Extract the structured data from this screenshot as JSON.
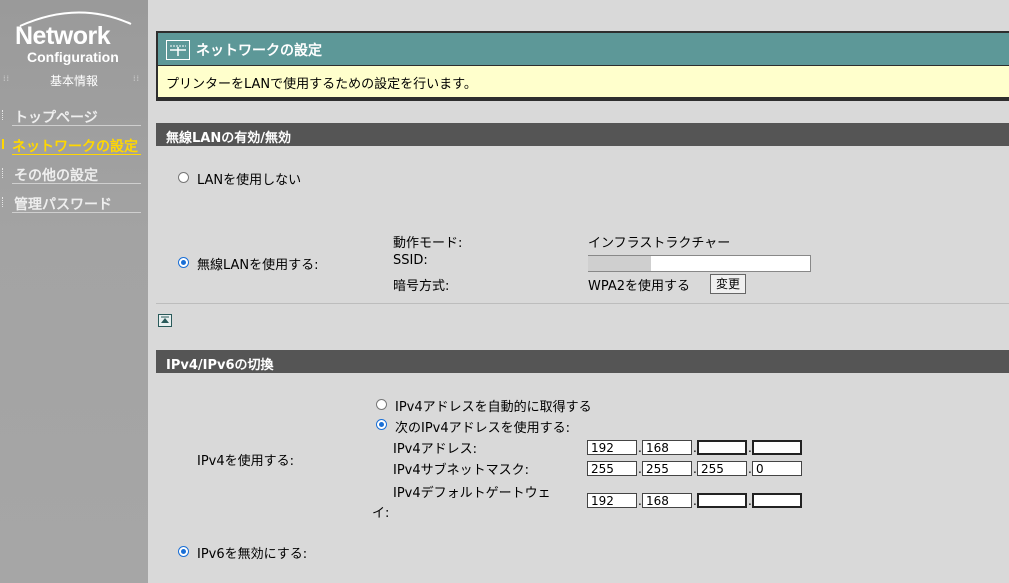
{
  "sidebar": {
    "logo_main": "Network",
    "logo_sub": "Configuration",
    "section": "基本情報",
    "items": [
      {
        "label": "トップページ",
        "active": false
      },
      {
        "label": "ネットワークの設定",
        "active": true
      },
      {
        "label": "その他の設定",
        "active": false
      },
      {
        "label": "管理パスワード",
        "active": false
      }
    ]
  },
  "header": {
    "title": "ネットワークの設定",
    "description": "プリンターをLANで使用するための設定を行います。"
  },
  "wlan": {
    "section_title": "無線LANの有効/無効",
    "option_off": "LANを使用しない",
    "option_on": "無線LANを使用する:",
    "mode_label": "動作モード:",
    "mode_value": "インフラストラクチャー",
    "ssid_label": "SSID:",
    "enc_label": "暗号方式:",
    "enc_value": "WPA2を使用する",
    "change_button": "変更",
    "selected": "on"
  },
  "ip": {
    "section_title": "IPv4/IPv6の切換",
    "use_ipv4": "IPv4を使用する:",
    "auto_option": "IPv4アドレスを自動的に取得する",
    "manual_option": "次のIPv4アドレスを使用する:",
    "addr_label": "IPv4アドレス:",
    "addr": [
      "192",
      "168",
      "",
      ""
    ],
    "mask_label": "IPv4サブネットマスク:",
    "mask": [
      "255",
      "255",
      "255",
      "0"
    ],
    "gw_label_1": "IPv4デフォルトゲートウェ",
    "gw_label_2": "イ:",
    "gw": [
      "192",
      "168",
      "",
      ""
    ],
    "ipv6_option": "IPv6を無効にする:"
  },
  "colors": {
    "title_bar": "#5d9898",
    "description_bg": "#ffffcc",
    "section_header": "#555555",
    "sidebar_active": "#ffd700"
  }
}
